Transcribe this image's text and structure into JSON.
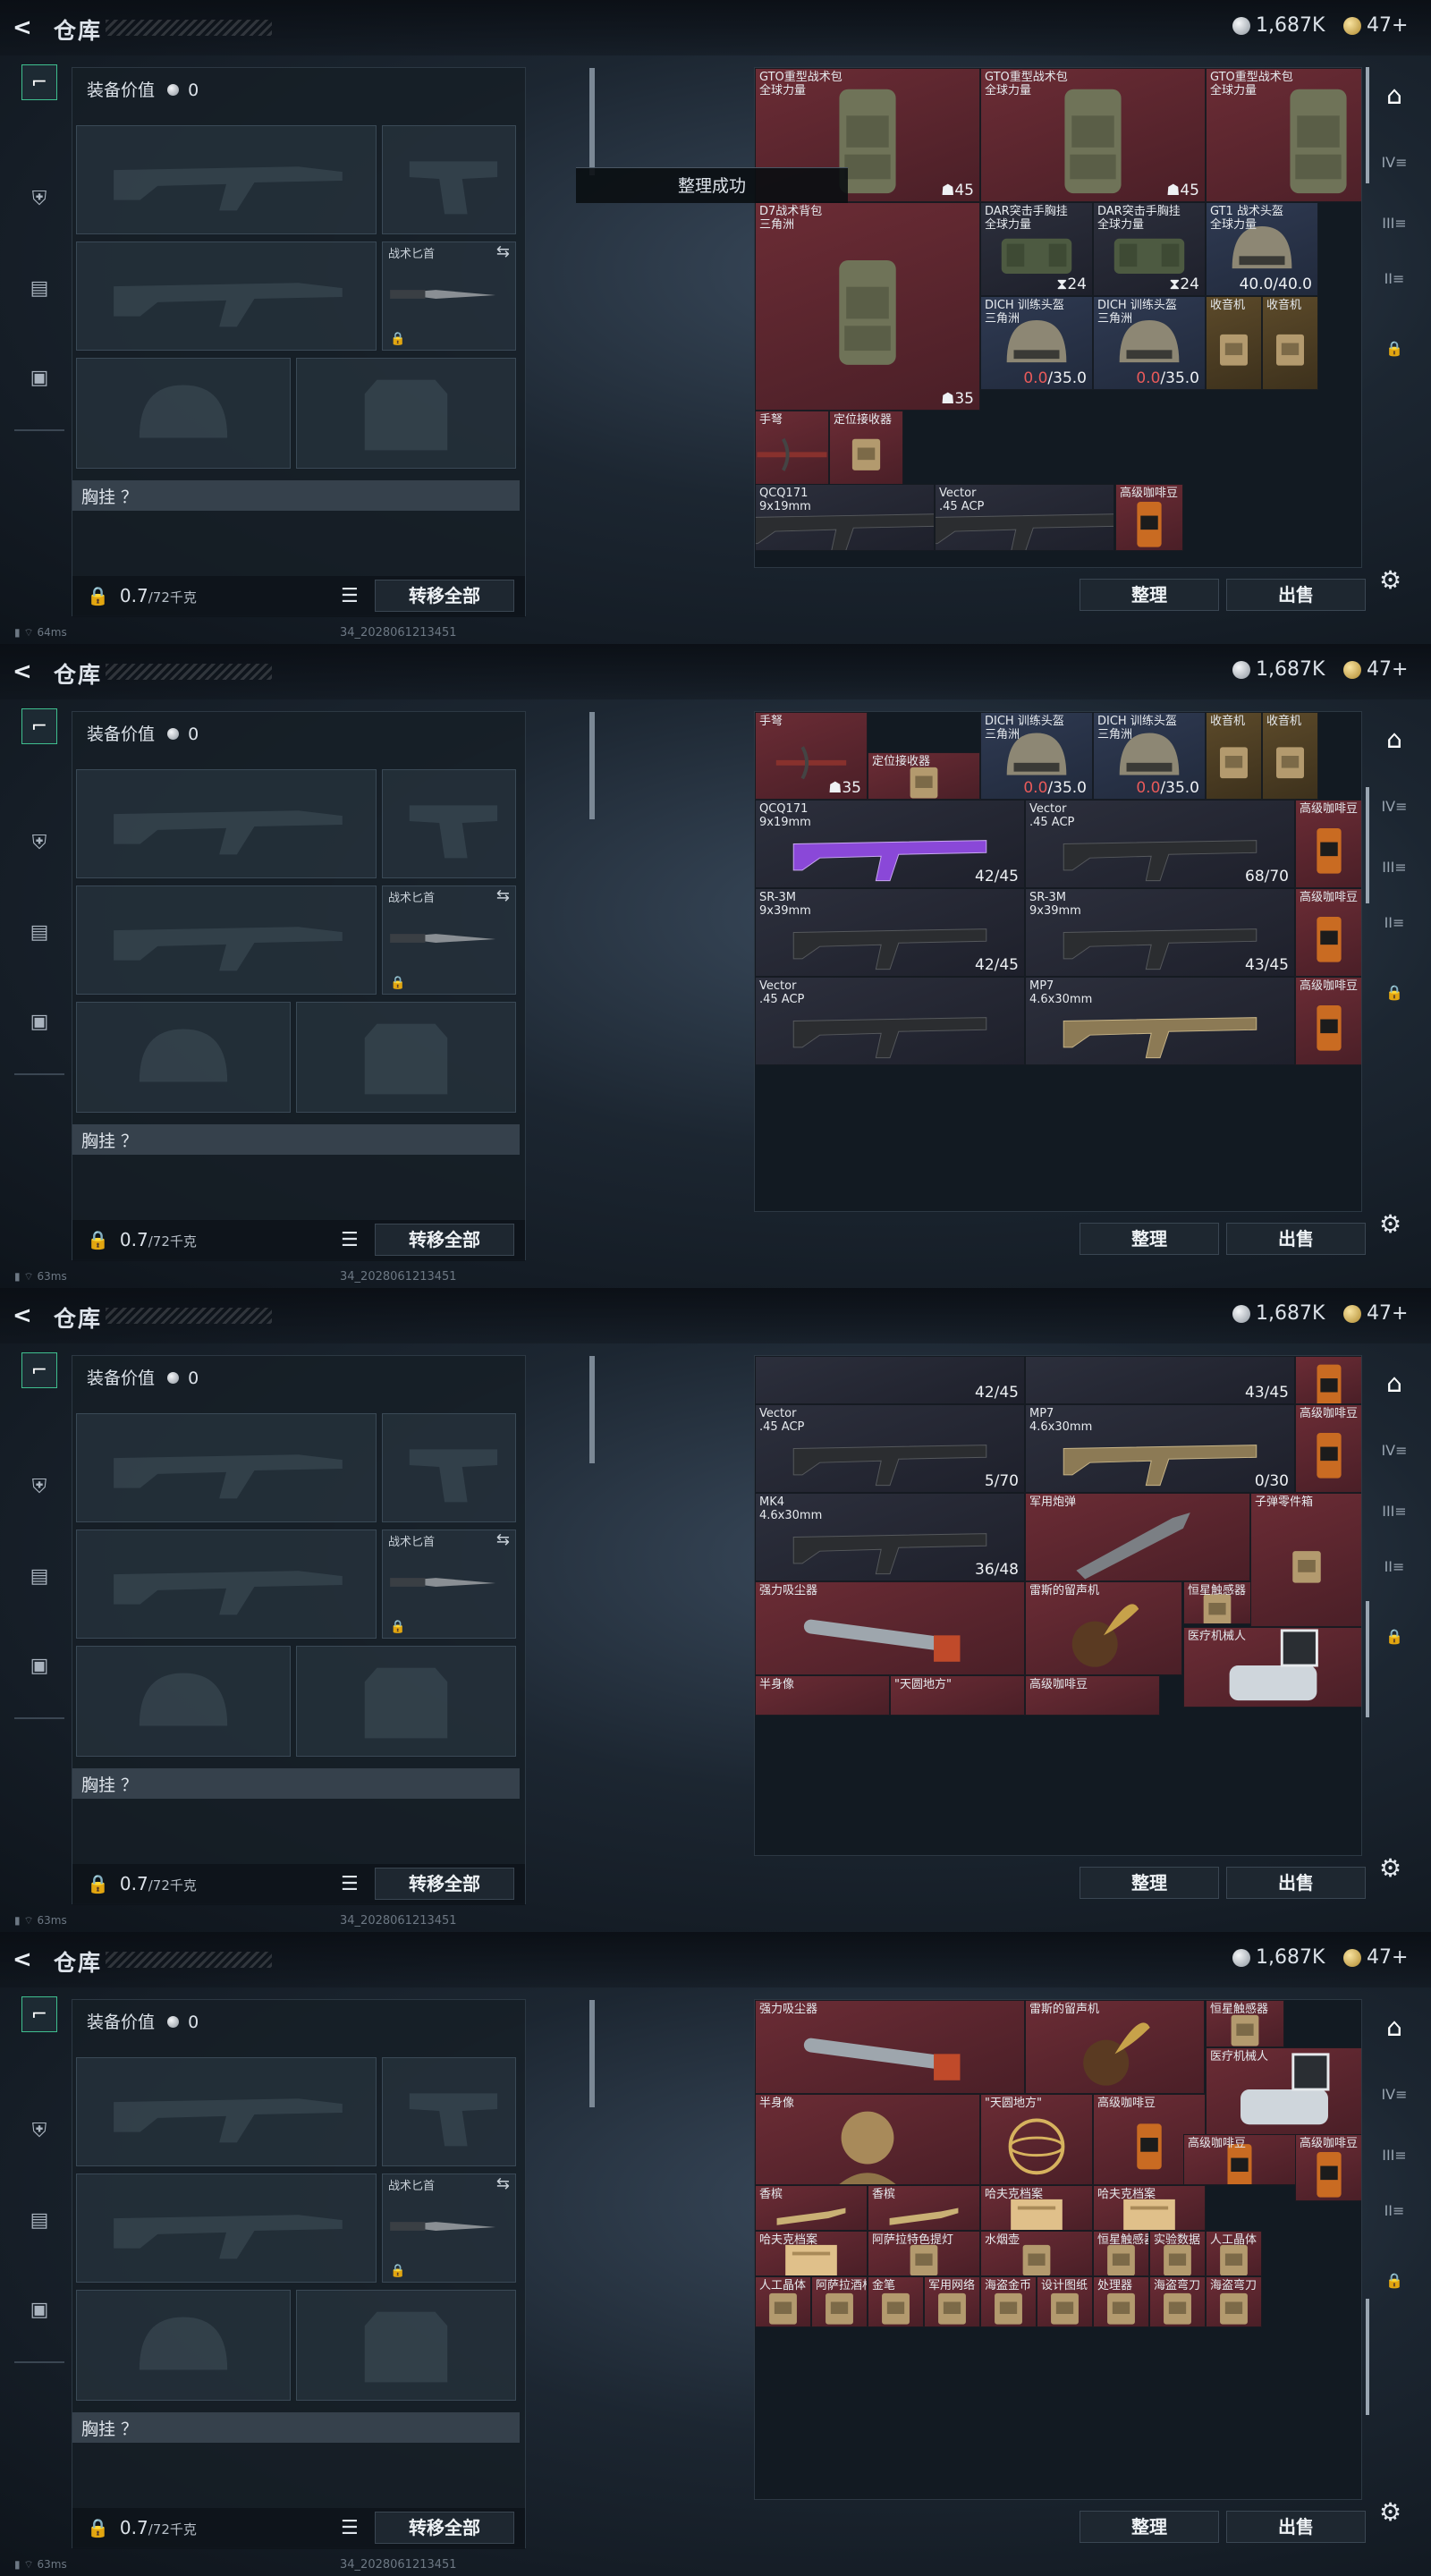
{
  "header": {
    "title": "仓库",
    "currency_silver": "1,687K",
    "currency_gold": "47+"
  },
  "equipment": {
    "value_label": "装备价值",
    "value": "0",
    "knife_label": "战术匕首",
    "vest_label": "胸挂 ？",
    "weight": "0.7",
    "weight_capacity": "/72千克",
    "transfer_all": "转移全部"
  },
  "actions": {
    "sort": "整理",
    "sell": "出售"
  },
  "toast": "整理成功",
  "status": {
    "build": "34_2028061213451",
    "pings": [
      "64ms",
      "63ms",
      "63ms",
      "63ms"
    ]
  },
  "screens": [
    {
      "items": [
        {
          "n": "GTO重型战术包\n全球力量",
          "c": "☗45",
          "bg": "red",
          "a": "bag",
          "col": 0,
          "row": 0,
          "w": 1,
          "h": 1
        },
        {
          "n": "GTO重型战术包\n全球力量",
          "c": "☗45",
          "bg": "red",
          "a": "bag",
          "col": 1,
          "row": 0,
          "w": 1,
          "h": 1
        },
        {
          "n": "GTO重型战术包\n全球力量",
          "c": "☗45",
          "bg": "red",
          "a": "bag",
          "col": 2,
          "row": 0,
          "w": 1,
          "h": 1
        },
        {
          "n": "D7战术背包\n三角洲",
          "c": "☗35",
          "bg": "red",
          "a": "bag",
          "col": 0,
          "row": 1,
          "w": 1,
          "h": 1.55
        },
        {
          "n": "DAR突击手胸挂\n全球力量",
          "c": "⧗24",
          "bg": "dark",
          "a": "vest",
          "col": 1,
          "row": 1,
          "w": 0.5,
          "h": 0.7
        },
        {
          "n": "DAR突击手胸挂\n全球力量",
          "c": "⧗24",
          "bg": "dark",
          "a": "vest",
          "col": 1.5,
          "row": 1,
          "w": 0.5,
          "h": 0.7
        },
        {
          "n": "GT1 战术头盔\n全球力量",
          "c": "40.0/40.0",
          "bg": "blue",
          "a": "helmet",
          "col": 2,
          "row": 1,
          "w": 0.5,
          "h": 0.7
        },
        {
          "n": "DICH 训练头盔\n三角洲",
          "c": "0.0/35.0",
          "bg": "blue",
          "a": "helmet",
          "col": 1,
          "row": 1.7,
          "w": 0.5,
          "h": 0.7
        },
        {
          "n": "DICH 训练头盔\n三角洲",
          "c": "0.0/35.0",
          "bg": "blue",
          "a": "helmet",
          "col": 1.5,
          "row": 1.7,
          "w": 0.5,
          "h": 0.7
        },
        {
          "n": "收音机",
          "c": "",
          "bg": "gold",
          "a": "box",
          "col": 2,
          "row": 1.7,
          "w": 0.25,
          "h": 0.7
        },
        {
          "n": "收音机",
          "c": "",
          "bg": "gold",
          "a": "box",
          "col": 2.25,
          "row": 1.7,
          "w": 0.25,
          "h": 0.7
        },
        {
          "n": "手弩",
          "c": "",
          "bg": "red",
          "a": "crossbow",
          "col": 0,
          "row": 2.55,
          "w": 0.33,
          "h": 0.55
        },
        {
          "n": "定位接收器",
          "c": "",
          "bg": "red",
          "a": "box",
          "col": 0.33,
          "row": 2.55,
          "w": 0.33,
          "h": 0.55
        },
        {
          "n": "QCQ171\n9x19mm",
          "c": "",
          "bg": "dark",
          "a": "gun",
          "col": 0,
          "row": 3.1,
          "w": 0.8,
          "h": 0.5
        },
        {
          "n": "Vector\n.45 ACP",
          "c": "",
          "bg": "dark",
          "a": "gun",
          "col": 0.8,
          "row": 3.1,
          "w": 0.8,
          "h": 0.5
        },
        {
          "n": "高级咖啡豆",
          "c": "",
          "bg": "red",
          "a": "coffee",
          "col": 1.6,
          "row": 3.1,
          "w": 0.3,
          "h": 0.5
        }
      ]
    },
    {
      "items": [
        {
          "n": "DICH 训练头盔\n三角洲",
          "c": "0.0/35.0",
          "bg": "blue",
          "a": "helmet",
          "col": 1,
          "row": 0,
          "w": 0.5,
          "h": 0.65
        },
        {
          "n": "DICH 训练头盔\n三角洲",
          "c": "0.0/35.0",
          "bg": "blue",
          "a": "helmet",
          "col": 1.5,
          "row": 0,
          "w": 0.5,
          "h": 0.65
        },
        {
          "n": "收音机",
          "c": "",
          "bg": "gold",
          "a": "box",
          "col": 2,
          "row": 0,
          "w": 0.25,
          "h": 0.65
        },
        {
          "n": "收音机",
          "c": "",
          "bg": "gold",
          "a": "box",
          "col": 2.25,
          "row": 0,
          "w": 0.25,
          "h": 0.65
        },
        {
          "n": "手弩",
          "c": "☗35",
          "bg": "red",
          "a": "crossbow",
          "col": 0,
          "row": 0,
          "w": 0.5,
          "h": 0.65
        },
        {
          "n": "定位接收器",
          "c": "",
          "bg": "red",
          "a": "box",
          "col": 0.5,
          "row": 0.3,
          "w": 0.5,
          "h": 0.35
        },
        {
          "n": "QCQ171\n9x19mm",
          "c": "42/45",
          "bg": "dark",
          "a": "gunp",
          "col": 0,
          "row": 0.65,
          "w": 1.2,
          "h": 0.66
        },
        {
          "n": "Vector\n.45 ACP",
          "c": "68/70",
          "bg": "dark",
          "a": "gun",
          "col": 1.2,
          "row": 0.65,
          "w": 1.2,
          "h": 0.66
        },
        {
          "n": "高级咖啡豆",
          "c": "",
          "bg": "red",
          "a": "coffee",
          "col": 2.4,
          "row": 0.65,
          "w": 0.3,
          "h": 0.66
        },
        {
          "n": "SR-3M\n9x39mm",
          "c": "42/45",
          "bg": "dark",
          "a": "gun",
          "col": 0,
          "row": 1.31,
          "w": 1.2,
          "h": 0.66
        },
        {
          "n": "SR-3M\n9x39mm",
          "c": "43/45",
          "bg": "dark",
          "a": "gun",
          "col": 1.2,
          "row": 1.31,
          "w": 1.2,
          "h": 0.66
        },
        {
          "n": "高级咖啡豆",
          "c": "",
          "bg": "red",
          "a": "coffee",
          "col": 2.4,
          "row": 1.31,
          "w": 0.3,
          "h": 0.66
        },
        {
          "n": "Vector\n.45 ACP",
          "c": "",
          "bg": "dark",
          "a": "gun",
          "col": 0,
          "row": 1.97,
          "w": 1.2,
          "h": 0.66
        },
        {
          "n": "MP7\n4.6x30mm",
          "c": "",
          "bg": "dark",
          "a": "gung",
          "col": 1.2,
          "row": 1.97,
          "w": 1.2,
          "h": 0.66
        },
        {
          "n": "高级咖啡豆",
          "c": "",
          "bg": "red",
          "a": "coffee",
          "col": 2.4,
          "row": 1.97,
          "w": 0.3,
          "h": 0.66
        }
      ]
    },
    {
      "items": [
        {
          "n": "",
          "c": "42/45",
          "bg": "dark",
          "a": "none",
          "col": 0,
          "row": 0,
          "w": 1.2,
          "h": 0.36
        },
        {
          "n": "",
          "c": "43/45",
          "bg": "dark",
          "a": "none",
          "col": 1.2,
          "row": 0,
          "w": 1.2,
          "h": 0.36
        },
        {
          "n": "",
          "c": "",
          "bg": "red",
          "a": "coffee",
          "col": 2.4,
          "row": 0,
          "w": 0.3,
          "h": 0.36
        },
        {
          "n": "Vector\n.45 ACP",
          "c": "5/70",
          "bg": "dark",
          "a": "gun",
          "col": 0,
          "row": 0.36,
          "w": 1.2,
          "h": 0.66
        },
        {
          "n": "MP7\n4.6x30mm",
          "c": "0/30",
          "bg": "dark",
          "a": "gung",
          "col": 1.2,
          "row": 0.36,
          "w": 1.2,
          "h": 0.66
        },
        {
          "n": "高级咖啡豆",
          "c": "",
          "bg": "red",
          "a": "coffee",
          "col": 2.4,
          "row": 0.36,
          "w": 0.3,
          "h": 0.66
        },
        {
          "n": "MK4\n4.6x30mm",
          "c": "36/48",
          "bg": "dark",
          "a": "gun",
          "col": 0,
          "row": 1.02,
          "w": 1.2,
          "h": 0.66
        },
        {
          "n": "军用炮弹",
          "c": "",
          "bg": "red",
          "a": "shell",
          "col": 1.2,
          "row": 1.02,
          "w": 1,
          "h": 0.66
        },
        {
          "n": "子弹零件箱",
          "c": "",
          "bg": "red",
          "a": "box",
          "col": 2.2,
          "row": 1.02,
          "w": 0.5,
          "h": 1
        },
        {
          "n": "强力吸尘器",
          "c": "",
          "bg": "red",
          "a": "vac",
          "col": 0,
          "row": 1.68,
          "w": 1.2,
          "h": 0.7
        },
        {
          "n": "雷斯的留声机",
          "c": "",
          "bg": "red",
          "a": "gramo",
          "col": 1.2,
          "row": 1.68,
          "w": 0.7,
          "h": 0.7
        },
        {
          "n": "恒星触感器",
          "c": "",
          "bg": "red",
          "a": "box",
          "col": 1.9,
          "row": 1.68,
          "w": 0.3,
          "h": 0.32
        },
        {
          "n": "医疗机械人",
          "c": "",
          "bg": "red",
          "a": "robot",
          "col": 1.9,
          "row": 2.02,
          "w": 0.8,
          "h": 0.6
        },
        {
          "n": "半身像",
          "c": "",
          "bg": "red",
          "a": "none",
          "col": 0,
          "row": 2.38,
          "w": 0.6,
          "h": 0.3
        },
        {
          "n": "\"天圆地方\"",
          "c": "",
          "bg": "red",
          "a": "none",
          "col": 0.6,
          "row": 2.38,
          "w": 0.6,
          "h": 0.3
        },
        {
          "n": "高级咖啡豆",
          "c": "",
          "bg": "red",
          "a": "none",
          "col": 1.2,
          "row": 2.38,
          "w": 0.6,
          "h": 0.3
        }
      ]
    },
    {
      "items": [
        {
          "n": "强力吸尘器",
          "c": "",
          "bg": "red",
          "a": "vac",
          "col": 0,
          "row": 0,
          "w": 1.2,
          "h": 0.7
        },
        {
          "n": "雷斯的留声机",
          "c": "",
          "bg": "red",
          "a": "gramo",
          "col": 1.2,
          "row": 0,
          "w": 0.8,
          "h": 0.7
        },
        {
          "n": "恒星触感器",
          "c": "",
          "bg": "red",
          "a": "box",
          "col": 2,
          "row": 0,
          "w": 0.35,
          "h": 0.35
        },
        {
          "n": "医疗机械人",
          "c": "",
          "bg": "red",
          "a": "robot",
          "col": 2,
          "row": 0.35,
          "w": 0.7,
          "h": 0.65
        },
        {
          "n": "半身像",
          "c": "",
          "bg": "red",
          "a": "bust",
          "col": 0,
          "row": 0.7,
          "w": 1,
          "h": 0.68
        },
        {
          "n": "\"天圆地方\"",
          "c": "",
          "bg": "red",
          "a": "globe",
          "col": 1,
          "row": 0.7,
          "w": 0.5,
          "h": 0.68
        },
        {
          "n": "高级咖啡豆",
          "c": "",
          "bg": "red",
          "a": "coffee",
          "col": 1.5,
          "row": 0.7,
          "w": 0.5,
          "h": 0.68
        },
        {
          "n": "高级咖啡豆",
          "c": "",
          "bg": "red",
          "a": "coffee",
          "col": 1.9,
          "row": 1,
          "w": 0.5,
          "h": 0.38
        },
        {
          "n": "高级咖啡豆",
          "c": "",
          "bg": "red",
          "a": "coffee",
          "col": 2.4,
          "row": 1,
          "w": 0.3,
          "h": 0.5
        },
        {
          "n": "香槟",
          "c": "",
          "bg": "red",
          "a": "bottle",
          "col": 0,
          "row": 1.38,
          "w": 0.5,
          "h": 0.34
        },
        {
          "n": "香槟",
          "c": "",
          "bg": "red",
          "a": "bottle",
          "col": 0.5,
          "row": 1.38,
          "w": 0.5,
          "h": 0.34
        },
        {
          "n": "哈夫克档案",
          "c": "",
          "bg": "red",
          "a": "doc",
          "col": 1,
          "row": 1.38,
          "w": 0.5,
          "h": 0.34
        },
        {
          "n": "哈夫克档案",
          "c": "",
          "bg": "red",
          "a": "doc",
          "col": 1.5,
          "row": 1.38,
          "w": 0.5,
          "h": 0.34
        },
        {
          "n": "哈夫克档案",
          "c": "",
          "bg": "red",
          "a": "doc",
          "col": 0,
          "row": 1.72,
          "w": 0.5,
          "h": 0.34
        },
        {
          "n": "阿萨拉特色提灯",
          "c": "",
          "bg": "red",
          "a": "box",
          "col": 0.5,
          "row": 1.72,
          "w": 0.5,
          "h": 0.34
        },
        {
          "n": "水烟壶",
          "c": "",
          "bg": "red",
          "a": "box",
          "col": 1,
          "row": 1.72,
          "w": 0.5,
          "h": 0.34
        },
        {
          "n": "恒星触感器",
          "c": "",
          "bg": "red",
          "a": "box",
          "col": 1.5,
          "row": 1.72,
          "w": 0.25,
          "h": 0.34
        },
        {
          "n": "实验数据",
          "c": "",
          "bg": "red",
          "a": "box",
          "col": 1.75,
          "row": 1.72,
          "w": 0.25,
          "h": 0.34
        },
        {
          "n": "人工晶体",
          "c": "",
          "bg": "red",
          "a": "box",
          "col": 2,
          "row": 1.72,
          "w": 0.25,
          "h": 0.34
        },
        {
          "n": "人工晶体",
          "c": "",
          "bg": "red",
          "a": "box",
          "col": 0,
          "row": 2.06,
          "w": 0.25,
          "h": 0.38
        },
        {
          "n": "阿萨拉酒杯",
          "c": "",
          "bg": "red",
          "a": "box",
          "col": 0.25,
          "row": 2.06,
          "w": 0.25,
          "h": 0.38
        },
        {
          "n": "金笔",
          "c": "",
          "bg": "red",
          "a": "box",
          "col": 0.5,
          "row": 2.06,
          "w": 0.25,
          "h": 0.38
        },
        {
          "n": "军用网络",
          "c": "",
          "bg": "red",
          "a": "box",
          "col": 0.75,
          "row": 2.06,
          "w": 0.25,
          "h": 0.38
        },
        {
          "n": "海盗金币",
          "c": "",
          "bg": "red",
          "a": "box",
          "col": 1,
          "row": 2.06,
          "w": 0.25,
          "h": 0.38
        },
        {
          "n": "设计图纸",
          "c": "",
          "bg": "red",
          "a": "box",
          "col": 1.25,
          "row": 2.06,
          "w": 0.25,
          "h": 0.38
        },
        {
          "n": "处理器",
          "c": "",
          "bg": "red",
          "a": "box",
          "col": 1.5,
          "row": 2.06,
          "w": 0.25,
          "h": 0.38
        },
        {
          "n": "海盗弯刀",
          "c": "",
          "bg": "red",
          "a": "box",
          "col": 1.75,
          "row": 2.06,
          "w": 0.25,
          "h": 0.38
        },
        {
          "n": "海盗弯刀",
          "c": "",
          "bg": "red",
          "a": "box",
          "col": 2,
          "row": 2.06,
          "w": 0.25,
          "h": 0.38
        }
      ]
    }
  ]
}
